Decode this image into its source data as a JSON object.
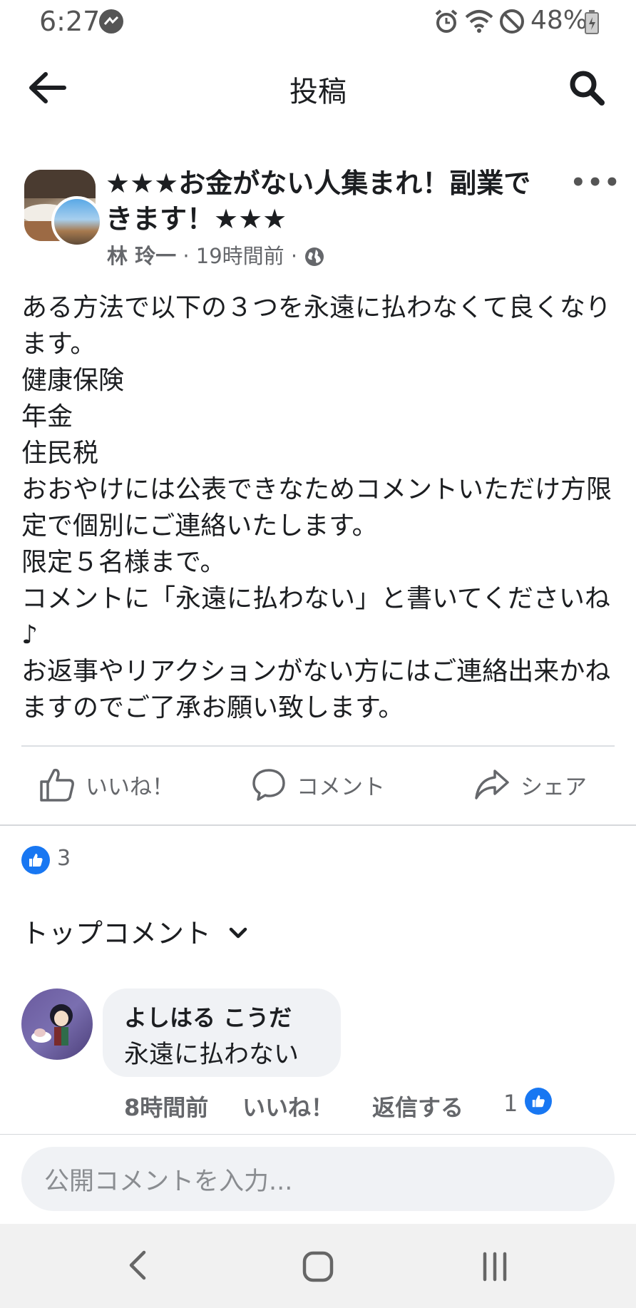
{
  "status_bar": {
    "time": "6:27",
    "battery": "48%"
  },
  "header": {
    "title": "投稿"
  },
  "post": {
    "title": "★★★お金がない人集まれ！副業できます！★★★",
    "author": "林 玲一",
    "time": "19時間前",
    "body": "ある方法で以下の３つを永遠に払わなくて良くなります。\n健康保険\n年金\n住民税\nおおやけには公表できなためコメントいただけ方限定で個別にご連絡いたします。\n限定５名様まで。\nコメントに「永遠に払わない」と書いてくださいね♪\nお返事やリアクションがない方にはご連絡出来かねますのでご了承お願い致します。"
  },
  "actions": {
    "like": "いいね！",
    "comment": "コメント",
    "share": "シェア"
  },
  "reactions": {
    "count": "3"
  },
  "comments_section": {
    "sort_label": "トップコメント"
  },
  "comment": {
    "author": "よしはる こうだ",
    "text": "永遠に払わない",
    "time": "8時間前",
    "like_label": "いいね！",
    "reply_label": "返信する",
    "like_count": "1"
  },
  "composer": {
    "placeholder": "公開コメントを入力..."
  },
  "colors": {
    "accent": "#1877f2",
    "muted": "#65676b",
    "bubble": "#f0f2f5"
  }
}
